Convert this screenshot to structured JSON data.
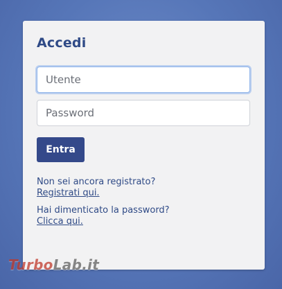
{
  "login": {
    "title": "Accedi",
    "username_placeholder": "Utente",
    "password_placeholder": "Password",
    "submit_label": "Entra",
    "register_prompt": "Non sei ancora registrato?",
    "register_link": "Registrati qui.",
    "forgot_prompt": "Hai dimenticato la password?",
    "forgot_link": "Clicca qui."
  },
  "watermark": {
    "part1": "Turbo",
    "part2": "Lab.it"
  },
  "colors": {
    "accent": "#34498a",
    "text": "#2f4a86",
    "card": "#f2f2f3",
    "background": "#5676b8"
  }
}
